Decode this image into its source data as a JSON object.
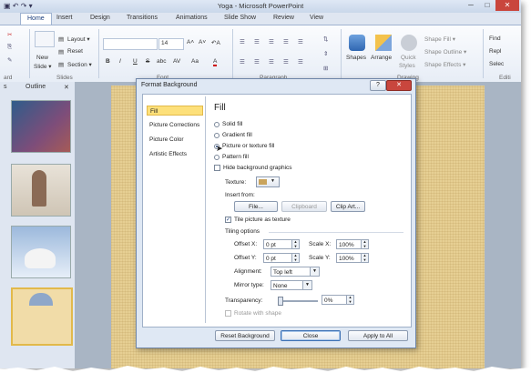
{
  "window": {
    "title": "Yoga - Microsoft PowerPoint",
    "quick_access": "▣ ↶ ↷ ▾",
    "controls": {
      "minimize": "─",
      "maximize": "□",
      "close": "✕"
    }
  },
  "tabs": [
    "Home",
    "Insert",
    "Design",
    "Transitions",
    "Animations",
    "Slide Show",
    "Review",
    "View"
  ],
  "ribbon": {
    "slides": {
      "new_slide": "New",
      "new_slide2": "Slide ▾",
      "layout": "Layout ▾",
      "reset": "Reset",
      "section": "Section ▾",
      "group": "Slides"
    },
    "font": {
      "size": "14",
      "grow": "A˄",
      "shrink": "A˅",
      "clear": "↶A",
      "bold": "B",
      "italic": "I",
      "underline": "U",
      "strike": "S",
      "shadow": "abc",
      "spacing": "AV",
      "case": "Aa",
      "color": "A",
      "group": "Font"
    },
    "paragraph": {
      "group": "Paragraph"
    },
    "drawing": {
      "shapes": "Shapes",
      "arrange": "Arrange",
      "quick_styles": "Quick",
      "quick_styles2": "Styles",
      "shape_fill": "Shape Fill ▾",
      "shape_outline": "Shape Outline ▾",
      "shape_effects": "Shape Effects ▾",
      "group": "Drawing"
    },
    "editing": {
      "find": "Find",
      "replace": "Repl",
      "select": "Selec",
      "group": "Editi"
    },
    "clipboard_group": "ard"
  },
  "left_pane": {
    "tab_slides": "s",
    "tab_outline": "Outline",
    "close": "✕"
  },
  "dialog": {
    "title": "Format Background",
    "help": "?",
    "close": "✕",
    "nav": [
      "Fill",
      "Picture Corrections",
      "Picture Color",
      "Artistic Effects"
    ],
    "section_title": "Fill",
    "fill_options": [
      {
        "label": "Solid fill",
        "u": "S",
        "rest": "olid fill",
        "selected": false
      },
      {
        "label": "Gradient fill",
        "u": "G",
        "rest": "radient fill",
        "selected": false
      },
      {
        "label": "Picture or texture fill",
        "u": "P",
        "rest": "icture or texture fill",
        "selected": true
      },
      {
        "label": "Pattern fill",
        "u": "A",
        "rest": "Pattern fill",
        "selected": false
      }
    ],
    "hide_graphics": "Hide background graphics",
    "texture_label": "Texture:",
    "insert_from": "Insert from:",
    "file_btn": "File...",
    "clipboard_btn": "Clipboard",
    "clipart_btn": "Clip Art...",
    "tile_label": "Tile picture as texture",
    "tiling_options": "Tiling options",
    "offset_x_label": "Offset X:",
    "offset_x": "0 pt",
    "offset_y_label": "Offset Y:",
    "offset_y": "0 pt",
    "scale_x_label": "Scale X:",
    "scale_x": "100%",
    "scale_y_label": "Scale Y:",
    "scale_y": "100%",
    "alignment_label": "Alignment:",
    "alignment": "Top left",
    "mirror_label": "Mirror type:",
    "mirror": "None",
    "transparency_label": "Transparency:",
    "transparency": "0%",
    "transparency_value": 0,
    "rotate_label": "Rotate with shape",
    "reset_btn": "Reset Background",
    "close_btn": "Close",
    "apply_btn": "Apply to All"
  },
  "colors": {
    "accent": "#2a5699",
    "selected_nav": "#fde07a",
    "close_red": "#c9463d",
    "slide_bg": "#e6cf93"
  }
}
